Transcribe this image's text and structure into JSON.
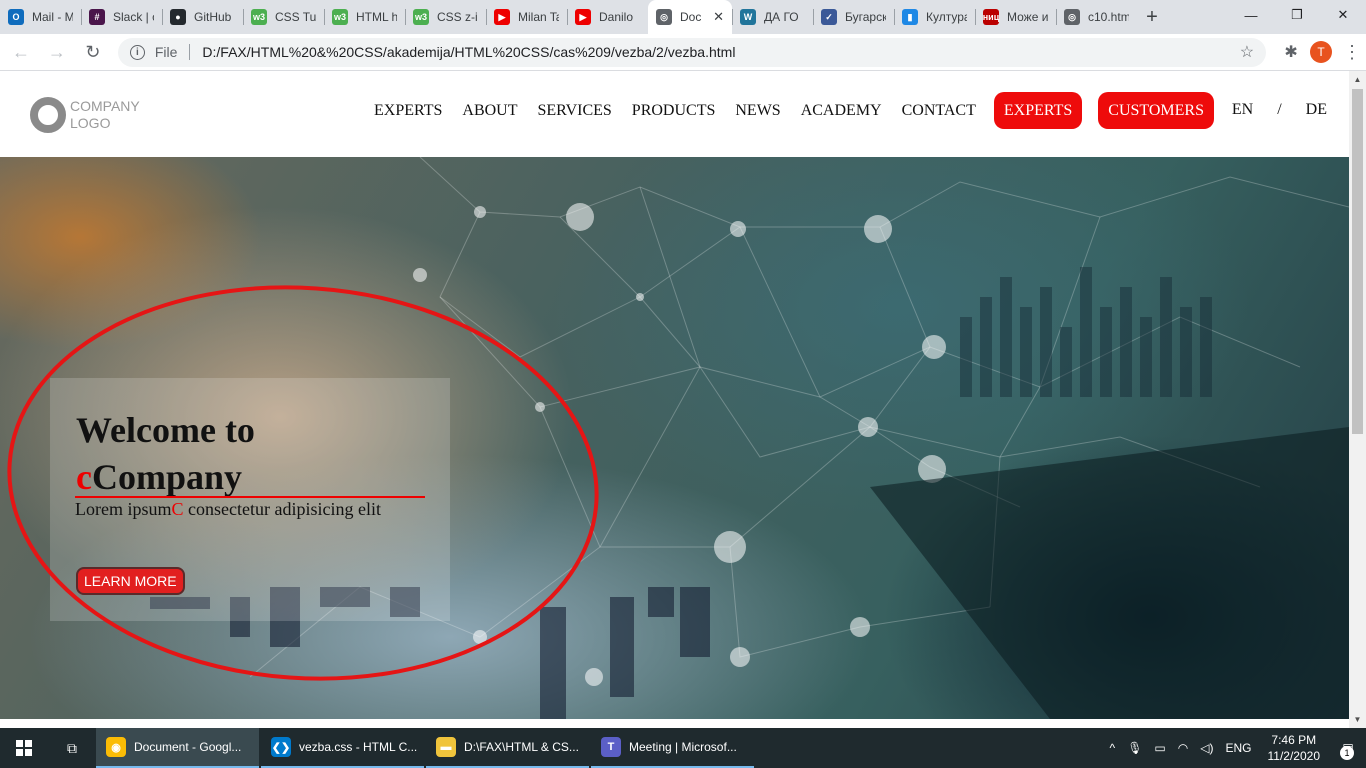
{
  "browser": {
    "tabs": [
      {
        "title": "Mail - M",
        "fav": "O",
        "color": "#0f6cbd"
      },
      {
        "title": "Slack | c",
        "fav": "#",
        "color": "#4a154b"
      },
      {
        "title": "GitHub",
        "fav": "●",
        "color": "#24292e"
      },
      {
        "title": "CSS Tut",
        "fav": "w3",
        "color": "#4caf50"
      },
      {
        "title": "HTML h",
        "fav": "w3",
        "color": "#4caf50"
      },
      {
        "title": "CSS z-ir",
        "fav": "w3",
        "color": "#4caf50"
      },
      {
        "title": "Milan Ta",
        "fav": "▶",
        "color": "#e00"
      },
      {
        "title": "Danilo",
        "fav": "▶",
        "color": "#e00"
      },
      {
        "title": "Doc",
        "fav": "◎",
        "color": "#5f6368",
        "active": true
      },
      {
        "title": "ДА ГО",
        "fav": "W",
        "color": "#21759b"
      },
      {
        "title": "Бугарск",
        "fav": "✓",
        "color": "#3b5998"
      },
      {
        "title": "Култура",
        "fav": "▮",
        "color": "#1e88e5"
      },
      {
        "title": "Може и",
        "fav": "ниц",
        "color": "#b00"
      },
      {
        "title": "c10.htm",
        "fav": "◎",
        "color": "#5f6368"
      }
    ],
    "new_tab": "+",
    "window_controls": {
      "minimize": "—",
      "maximize": "❐",
      "close": "✕"
    },
    "nav": {
      "back": "←",
      "forward": "→",
      "reload": "↻"
    },
    "address": {
      "info": "i",
      "scheme_label": "File",
      "url": "D:/FAX/HTML%20&%20CSS/akademija/HTML%20CSS/cas%209/vezba/2/vezba.html",
      "star": "☆"
    },
    "extensions_icon": "✱",
    "profile_initial": "T",
    "menu": "⋮",
    "tab_close": "✕"
  },
  "site": {
    "logo": {
      "line1": "COMPANY",
      "line2": "LOGO"
    },
    "nav_items": [
      "EXPERTS",
      "ABOUT",
      "SERVICES",
      "PRODUCTS",
      "NEWS",
      "ACADEMY",
      "CONTACT"
    ],
    "nav_buttons": [
      "EXPERTS",
      "CUSTOMERS"
    ],
    "lang": {
      "en": "EN",
      "sep": "/",
      "de": "DE"
    },
    "hero": {
      "title_line1": "Welcome to",
      "title_accent": "c",
      "title_rest": "Company",
      "sub_before": "Lorem ipsum",
      "sub_accent": "C",
      "sub_after": " consectetur adipisicing elit",
      "button": "LEARN MORE"
    },
    "accent_color": "#ee0b0b"
  },
  "taskbar": {
    "apps": [
      {
        "label": "Document - Googl...",
        "icon": "◉",
        "color": "#fbbc05",
        "active": true
      },
      {
        "label": "vezba.css - HTML C...",
        "icon": "❮❯",
        "color": "#007acc"
      },
      {
        "label": "D:\\FAX\\HTML & CS...",
        "icon": "▬",
        "color": "#f0c43c"
      },
      {
        "label": "Meeting | Microsof...",
        "icon": "T",
        "color": "#5b5fc7"
      }
    ],
    "tray": {
      "chevron": "^",
      "mic": "🎙",
      "battery": "▭",
      "wifi": "◠",
      "volume": "◁)",
      "lang": "ENG"
    },
    "time": "7:46 PM",
    "date": "11/2/2020",
    "notifications": "1"
  }
}
